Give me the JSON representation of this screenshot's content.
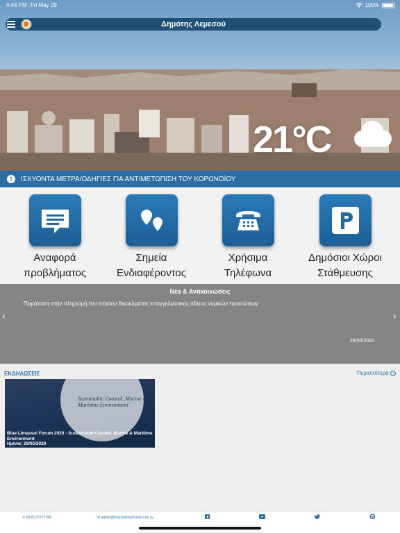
{
  "status_bar": {
    "time": "4:46 PM",
    "date": "Fri May 29",
    "battery": "100%"
  },
  "header": {
    "title": "Δημότης Λεμεσού"
  },
  "weather": {
    "temperature": "21°C",
    "icon": "cloud-icon"
  },
  "alert": {
    "text": "ΙΣΧΥΟΝΤΑ ΜΕΤΡΑ/ΟΔΗΓΙΕΣ ΓΙΑ ΑΝΤΙΜΕΤΩΠΙΣΗ ΤΟΥ ΚΟΡΩΝΟΪΟΥ"
  },
  "tiles": [
    {
      "line1": "Αναφορά",
      "line2": "προβλήματος",
      "icon": "chat-icon"
    },
    {
      "line1": "Σημεία",
      "line2": "Ενδιαφέροντος",
      "icon": "map-pin-icon"
    },
    {
      "line1": "Χρήσιμα",
      "line2": "Τηλέφωνα",
      "icon": "phone-icon"
    },
    {
      "line1": "Δημόσιοι Χώροι",
      "line2": "Στάθμευσης",
      "icon": "parking-icon"
    }
  ],
  "news": {
    "heading": "Νέα & Ανακοινώσεις",
    "item_text": "Παράταση στην πληρωμή του ετήσιου δικαιώματος επαγγελματικής άδειας νομικών προσώπων",
    "item_date": "28/05/2020"
  },
  "events": {
    "title": "ΕΚΔΗΛΩΣΕΙΣ",
    "more_label": "Περισσότερα",
    "card": {
      "poster_title": "Sustainable Coastal, Marine & Maritime Environment",
      "caption": "Blue Limassol Forum 2020 - Sustainable Coastal, Marine & Maritime Environment",
      "date_line": "Ημ/νία: 29/05/2020"
    }
  },
  "footer": {
    "phone": "0035777777788",
    "email": "admin@limassolmunicipal.com.cy"
  }
}
